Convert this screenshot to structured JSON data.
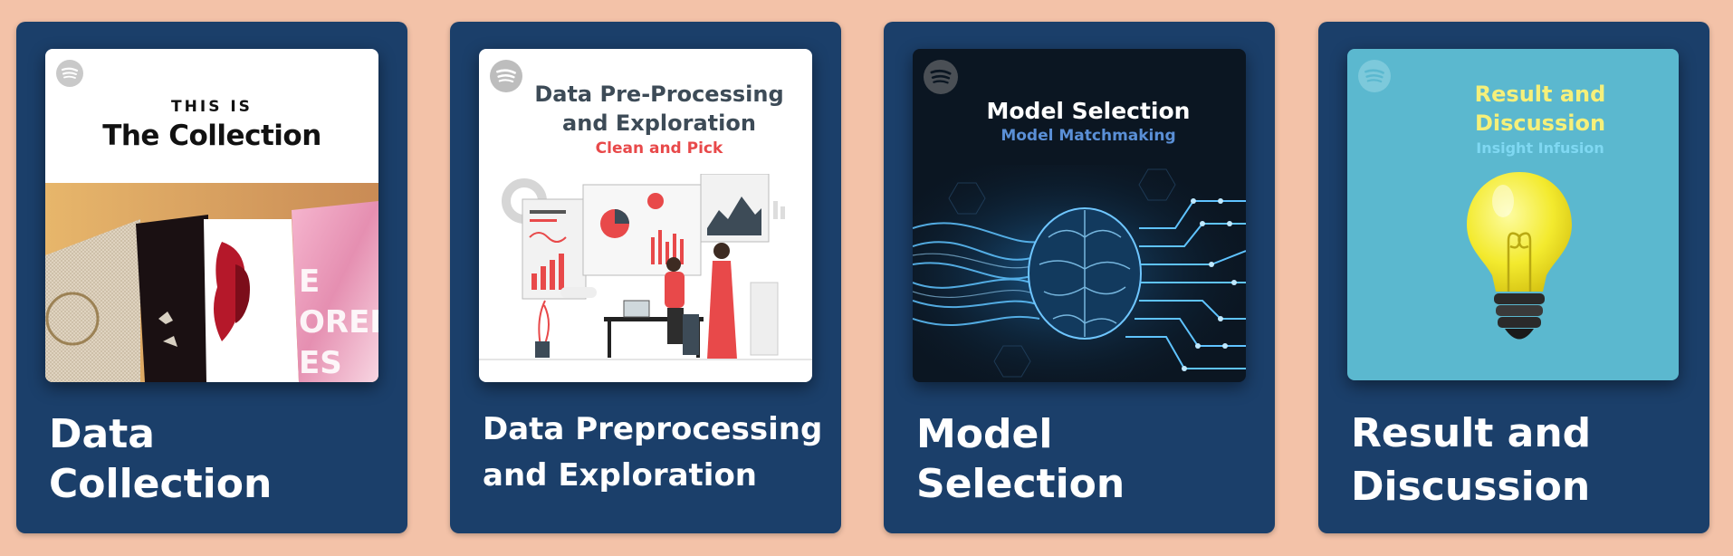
{
  "cards": [
    {
      "caption": "Data Collection",
      "cover": {
        "kicker": "THIS IS",
        "title": "The Collection",
        "art_text": "E\nORED\nES"
      }
    },
    {
      "caption": "Data Preprocessing and Exploration",
      "cover": {
        "title_line1": "Data Pre-Processing",
        "title_line2": "and Exploration",
        "subtitle": "Clean and Pick"
      }
    },
    {
      "caption": "Model Selection",
      "cover": {
        "title": "Model Selection",
        "subtitle": "Model Matchmaking"
      }
    },
    {
      "caption": "Result and Discussion",
      "cover": {
        "title_line1": "Result and",
        "title_line2": "Discussion",
        "subtitle": "Insight Infusion"
      }
    }
  ],
  "colors": {
    "background": "#f3c2a8",
    "card": "#1b3f6a",
    "accent_red": "#e8494a",
    "accent_blue": "#5a8fd6",
    "accent_yellow": "#f5f07a",
    "accent_cyan": "#7fd8f2"
  },
  "icons": [
    "spotify-icon",
    "lightbulb-icon",
    "brain-circuit-icon"
  ]
}
